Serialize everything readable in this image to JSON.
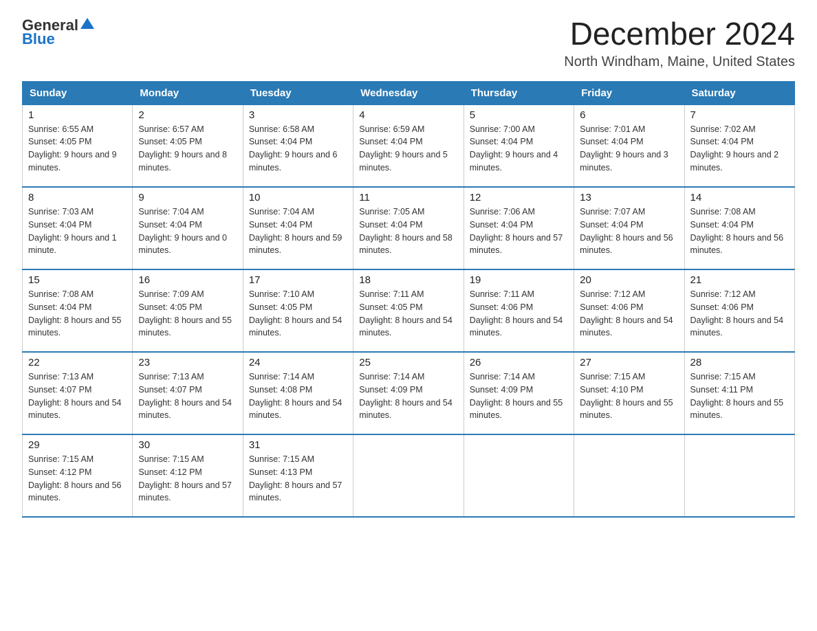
{
  "logo": {
    "text_general": "General",
    "text_blue": "Blue"
  },
  "header": {
    "month_title": "December 2024",
    "location": "North Windham, Maine, United States"
  },
  "days_of_week": [
    "Sunday",
    "Monday",
    "Tuesday",
    "Wednesday",
    "Thursday",
    "Friday",
    "Saturday"
  ],
  "weeks": [
    [
      {
        "day": "1",
        "sunrise": "6:55 AM",
        "sunset": "4:05 PM",
        "daylight": "9 hours and 9 minutes."
      },
      {
        "day": "2",
        "sunrise": "6:57 AM",
        "sunset": "4:05 PM",
        "daylight": "9 hours and 8 minutes."
      },
      {
        "day": "3",
        "sunrise": "6:58 AM",
        "sunset": "4:04 PM",
        "daylight": "9 hours and 6 minutes."
      },
      {
        "day": "4",
        "sunrise": "6:59 AM",
        "sunset": "4:04 PM",
        "daylight": "9 hours and 5 minutes."
      },
      {
        "day": "5",
        "sunrise": "7:00 AM",
        "sunset": "4:04 PM",
        "daylight": "9 hours and 4 minutes."
      },
      {
        "day": "6",
        "sunrise": "7:01 AM",
        "sunset": "4:04 PM",
        "daylight": "9 hours and 3 minutes."
      },
      {
        "day": "7",
        "sunrise": "7:02 AM",
        "sunset": "4:04 PM",
        "daylight": "9 hours and 2 minutes."
      }
    ],
    [
      {
        "day": "8",
        "sunrise": "7:03 AM",
        "sunset": "4:04 PM",
        "daylight": "9 hours and 1 minute."
      },
      {
        "day": "9",
        "sunrise": "7:04 AM",
        "sunset": "4:04 PM",
        "daylight": "9 hours and 0 minutes."
      },
      {
        "day": "10",
        "sunrise": "7:04 AM",
        "sunset": "4:04 PM",
        "daylight": "8 hours and 59 minutes."
      },
      {
        "day": "11",
        "sunrise": "7:05 AM",
        "sunset": "4:04 PM",
        "daylight": "8 hours and 58 minutes."
      },
      {
        "day": "12",
        "sunrise": "7:06 AM",
        "sunset": "4:04 PM",
        "daylight": "8 hours and 57 minutes."
      },
      {
        "day": "13",
        "sunrise": "7:07 AM",
        "sunset": "4:04 PM",
        "daylight": "8 hours and 56 minutes."
      },
      {
        "day": "14",
        "sunrise": "7:08 AM",
        "sunset": "4:04 PM",
        "daylight": "8 hours and 56 minutes."
      }
    ],
    [
      {
        "day": "15",
        "sunrise": "7:08 AM",
        "sunset": "4:04 PM",
        "daylight": "8 hours and 55 minutes."
      },
      {
        "day": "16",
        "sunrise": "7:09 AM",
        "sunset": "4:05 PM",
        "daylight": "8 hours and 55 minutes."
      },
      {
        "day": "17",
        "sunrise": "7:10 AM",
        "sunset": "4:05 PM",
        "daylight": "8 hours and 54 minutes."
      },
      {
        "day": "18",
        "sunrise": "7:11 AM",
        "sunset": "4:05 PM",
        "daylight": "8 hours and 54 minutes."
      },
      {
        "day": "19",
        "sunrise": "7:11 AM",
        "sunset": "4:06 PM",
        "daylight": "8 hours and 54 minutes."
      },
      {
        "day": "20",
        "sunrise": "7:12 AM",
        "sunset": "4:06 PM",
        "daylight": "8 hours and 54 minutes."
      },
      {
        "day": "21",
        "sunrise": "7:12 AM",
        "sunset": "4:06 PM",
        "daylight": "8 hours and 54 minutes."
      }
    ],
    [
      {
        "day": "22",
        "sunrise": "7:13 AM",
        "sunset": "4:07 PM",
        "daylight": "8 hours and 54 minutes."
      },
      {
        "day": "23",
        "sunrise": "7:13 AM",
        "sunset": "4:07 PM",
        "daylight": "8 hours and 54 minutes."
      },
      {
        "day": "24",
        "sunrise": "7:14 AM",
        "sunset": "4:08 PM",
        "daylight": "8 hours and 54 minutes."
      },
      {
        "day": "25",
        "sunrise": "7:14 AM",
        "sunset": "4:09 PM",
        "daylight": "8 hours and 54 minutes."
      },
      {
        "day": "26",
        "sunrise": "7:14 AM",
        "sunset": "4:09 PM",
        "daylight": "8 hours and 55 minutes."
      },
      {
        "day": "27",
        "sunrise": "7:15 AM",
        "sunset": "4:10 PM",
        "daylight": "8 hours and 55 minutes."
      },
      {
        "day": "28",
        "sunrise": "7:15 AM",
        "sunset": "4:11 PM",
        "daylight": "8 hours and 55 minutes."
      }
    ],
    [
      {
        "day": "29",
        "sunrise": "7:15 AM",
        "sunset": "4:12 PM",
        "daylight": "8 hours and 56 minutes."
      },
      {
        "day": "30",
        "sunrise": "7:15 AM",
        "sunset": "4:12 PM",
        "daylight": "8 hours and 57 minutes."
      },
      {
        "day": "31",
        "sunrise": "7:15 AM",
        "sunset": "4:13 PM",
        "daylight": "8 hours and 57 minutes."
      },
      null,
      null,
      null,
      null
    ]
  ]
}
